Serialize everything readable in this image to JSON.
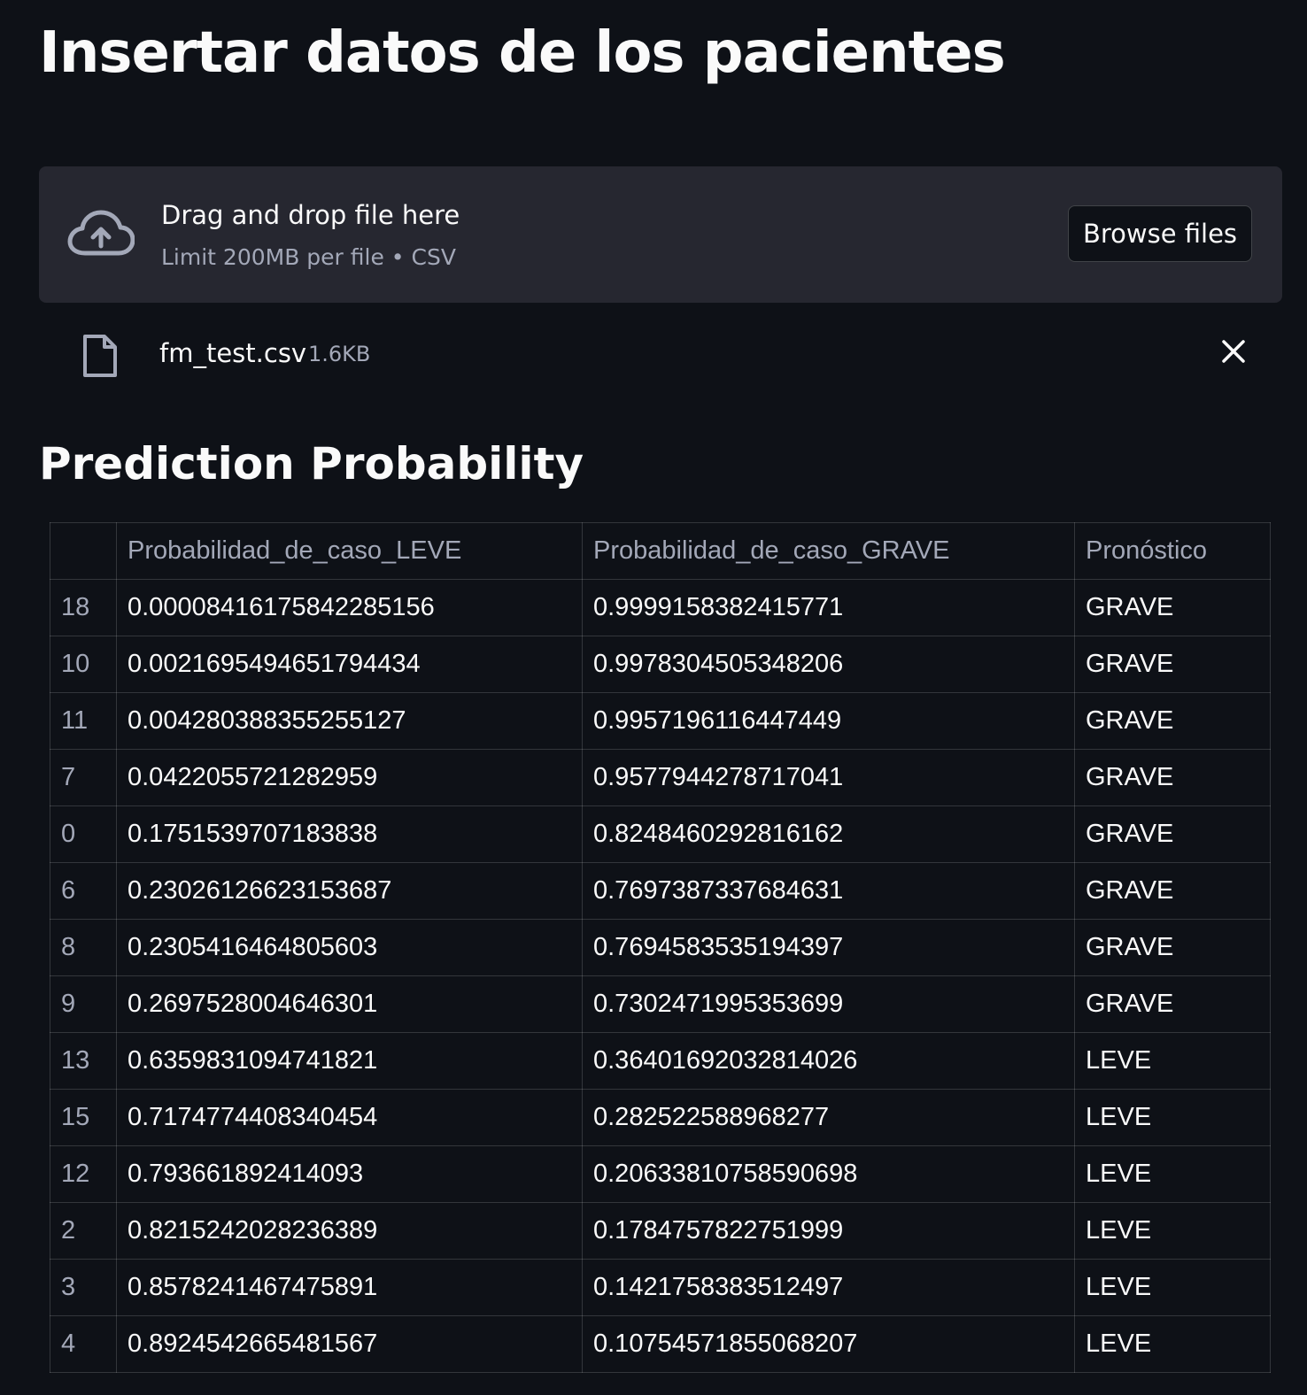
{
  "page": {
    "title": "Insertar datos de los pacientes"
  },
  "uploader": {
    "icon": "cloud-upload-icon",
    "drop_text": "Drag and drop file here",
    "limit_text": "Limit 200MB per file • CSV",
    "browse_label": "Browse files"
  },
  "uploaded_file": {
    "icon": "file-icon",
    "name": "fm_test.csv",
    "size": "1.6KB",
    "remove_icon": "close-icon"
  },
  "section": {
    "title": "Prediction Probability"
  },
  "table": {
    "columns": [
      "",
      "Probabilidad_de_caso_LEVE",
      "Probabilidad_de_caso_GRAVE",
      "Pronóstico"
    ],
    "rows": [
      {
        "index": "18",
        "leve": "0.00008416175842285156",
        "grave": "0.9999158382415771",
        "pronostico": "GRAVE"
      },
      {
        "index": "10",
        "leve": "0.0021695494651794434",
        "grave": "0.9978304505348206",
        "pronostico": "GRAVE"
      },
      {
        "index": "11",
        "leve": "0.004280388355255127",
        "grave": "0.9957196116447449",
        "pronostico": "GRAVE"
      },
      {
        "index": "7",
        "leve": "0.0422055721282959",
        "grave": "0.9577944278717041",
        "pronostico": "GRAVE"
      },
      {
        "index": "0",
        "leve": "0.1751539707183838",
        "grave": "0.8248460292816162",
        "pronostico": "GRAVE"
      },
      {
        "index": "6",
        "leve": "0.23026126623153687",
        "grave": "0.7697387337684631",
        "pronostico": "GRAVE"
      },
      {
        "index": "8",
        "leve": "0.2305416464805603",
        "grave": "0.7694583535194397",
        "pronostico": "GRAVE"
      },
      {
        "index": "9",
        "leve": "0.2697528004646301",
        "grave": "0.7302471995353699",
        "pronostico": "GRAVE"
      },
      {
        "index": "13",
        "leve": "0.6359831094741821",
        "grave": "0.36401692032814026",
        "pronostico": "LEVE"
      },
      {
        "index": "15",
        "leve": "0.7174774408340454",
        "grave": "0.282522588968277",
        "pronostico": "LEVE"
      },
      {
        "index": "12",
        "leve": "0.793661892414093",
        "grave": "0.20633810758590698",
        "pronostico": "LEVE"
      },
      {
        "index": "2",
        "leve": "0.8215242028236389",
        "grave": "0.1784757822751999",
        "pronostico": "LEVE"
      },
      {
        "index": "3",
        "leve": "0.8578241467475891",
        "grave": "0.1421758383512497",
        "pronostico": "LEVE"
      },
      {
        "index": "4",
        "leve": "0.8924542665481567",
        "grave": "0.10754571855068207",
        "pronostico": "LEVE"
      }
    ]
  }
}
